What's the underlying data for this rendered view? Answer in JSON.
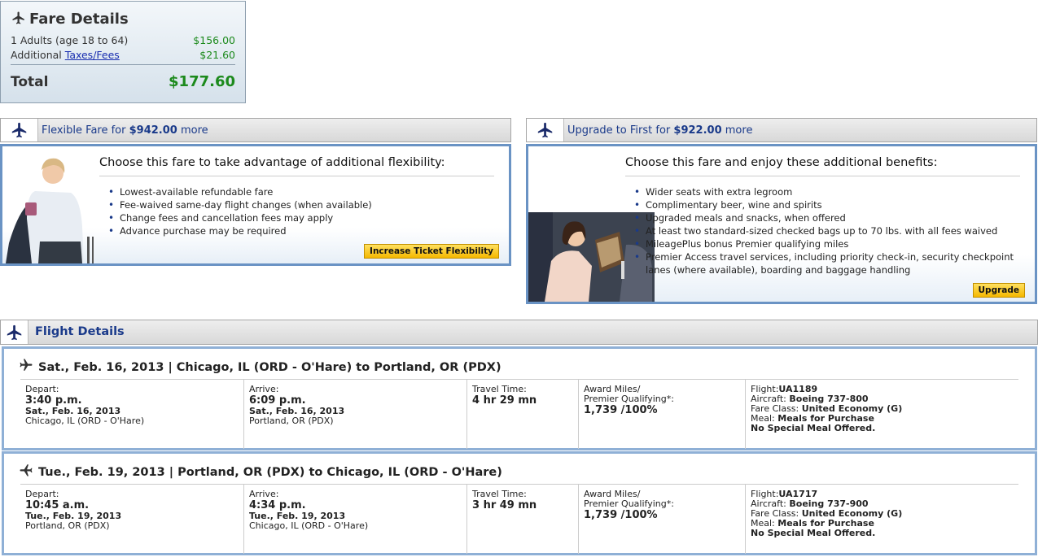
{
  "fare": {
    "title": "Fare Details",
    "adults_label": "1 Adults (age 18 to 64)",
    "adults_amount": "$156.00",
    "additional_label": "Additional",
    "taxes_link": "Taxes/Fees",
    "taxes_amount": "$21.60",
    "total_label": "Total",
    "total_amount": "$177.60"
  },
  "flexible": {
    "header_prefix": "Flexible Fare for",
    "header_amount": "$942.00",
    "header_suffix": "more",
    "headline": "Choose this fare to take advantage of additional flexibility:",
    "bullets": [
      "Lowest-available refundable fare",
      "Fee-waived same-day flight changes (when available)",
      "Change fees and cancellation fees may apply",
      "Advance purchase may be required"
    ],
    "button": "Increase Ticket Flexibility"
  },
  "first": {
    "header_prefix": "Upgrade to First for",
    "header_amount": "$922.00",
    "header_suffix": "more",
    "headline": "Choose this fare and enjoy these additional benefits:",
    "bullets": [
      "Wider seats with extra legroom",
      "Complimentary beer, wine and spirits",
      "Upgraded meals and snacks, when offered",
      "At least two standard-sized checked bags up to 70 lbs. with all fees waived",
      "MileagePlus bonus Premier qualifying miles",
      "Premier Access travel services, including priority check-in, security checkpoint lanes (where available), boarding and baggage handling"
    ],
    "button": "Upgrade"
  },
  "flight_details": {
    "title": "Flight Details",
    "labels": {
      "depart": "Depart:",
      "arrive": "Arrive:",
      "travel_time": "Travel Time:",
      "award_miles_1": "Award Miles/",
      "award_miles_2": "Premier Qualifying*:",
      "flight": "Flight:",
      "aircraft": "Aircraft:",
      "fare_class": "Fare Class:",
      "meal": "Meal:"
    },
    "segments": [
      {
        "route": "Sat., Feb. 16, 2013 | Chicago, IL (ORD - O'Hare) to Portland, OR (PDX)",
        "depart_time": "3:40 p.m.",
        "depart_date": "Sat., Feb. 16, 2013",
        "depart_place": "Chicago, IL (ORD - O'Hare)",
        "arrive_time": "6:09 p.m.",
        "arrive_date": "Sat., Feb. 16, 2013",
        "arrive_place": "Portland, OR (PDX)",
        "travel_time": "4 hr 29 mn",
        "miles": "1,739 /100%",
        "flight": "UA1189",
        "aircraft": "Boeing 737-800",
        "fare_class": "United Economy (G)",
        "meal": "Meals for Purchase",
        "special_meal": "No Special Meal Offered."
      },
      {
        "route": "Tue., Feb. 19, 2013 | Portland, OR (PDX) to Chicago, IL (ORD - O'Hare)",
        "depart_time": "10:45 a.m.",
        "depart_date": "Tue., Feb. 19, 2013",
        "depart_place": "Portland, OR (PDX)",
        "arrive_time": "4:34 p.m.",
        "arrive_date": "Tue., Feb. 19, 2013",
        "arrive_place": "Chicago, IL (ORD - O'Hare)",
        "travel_time": "3 hr 49 mn",
        "miles": "1,739 /100%",
        "flight": "UA1717",
        "aircraft": "Boeing 737-900",
        "fare_class": "United Economy (G)",
        "meal": "Meals for Purchase",
        "special_meal": "No Special Meal Offered."
      }
    ]
  },
  "colors": {
    "price_green": "#1c8a1c",
    "header_blue": "#1a3a8a",
    "button_yellow": "#f5b800",
    "panel_border": "#6a93c4"
  },
  "icons": {
    "fare": "plane-icon",
    "panel": "plane-icon",
    "segment": "plane-icon"
  }
}
